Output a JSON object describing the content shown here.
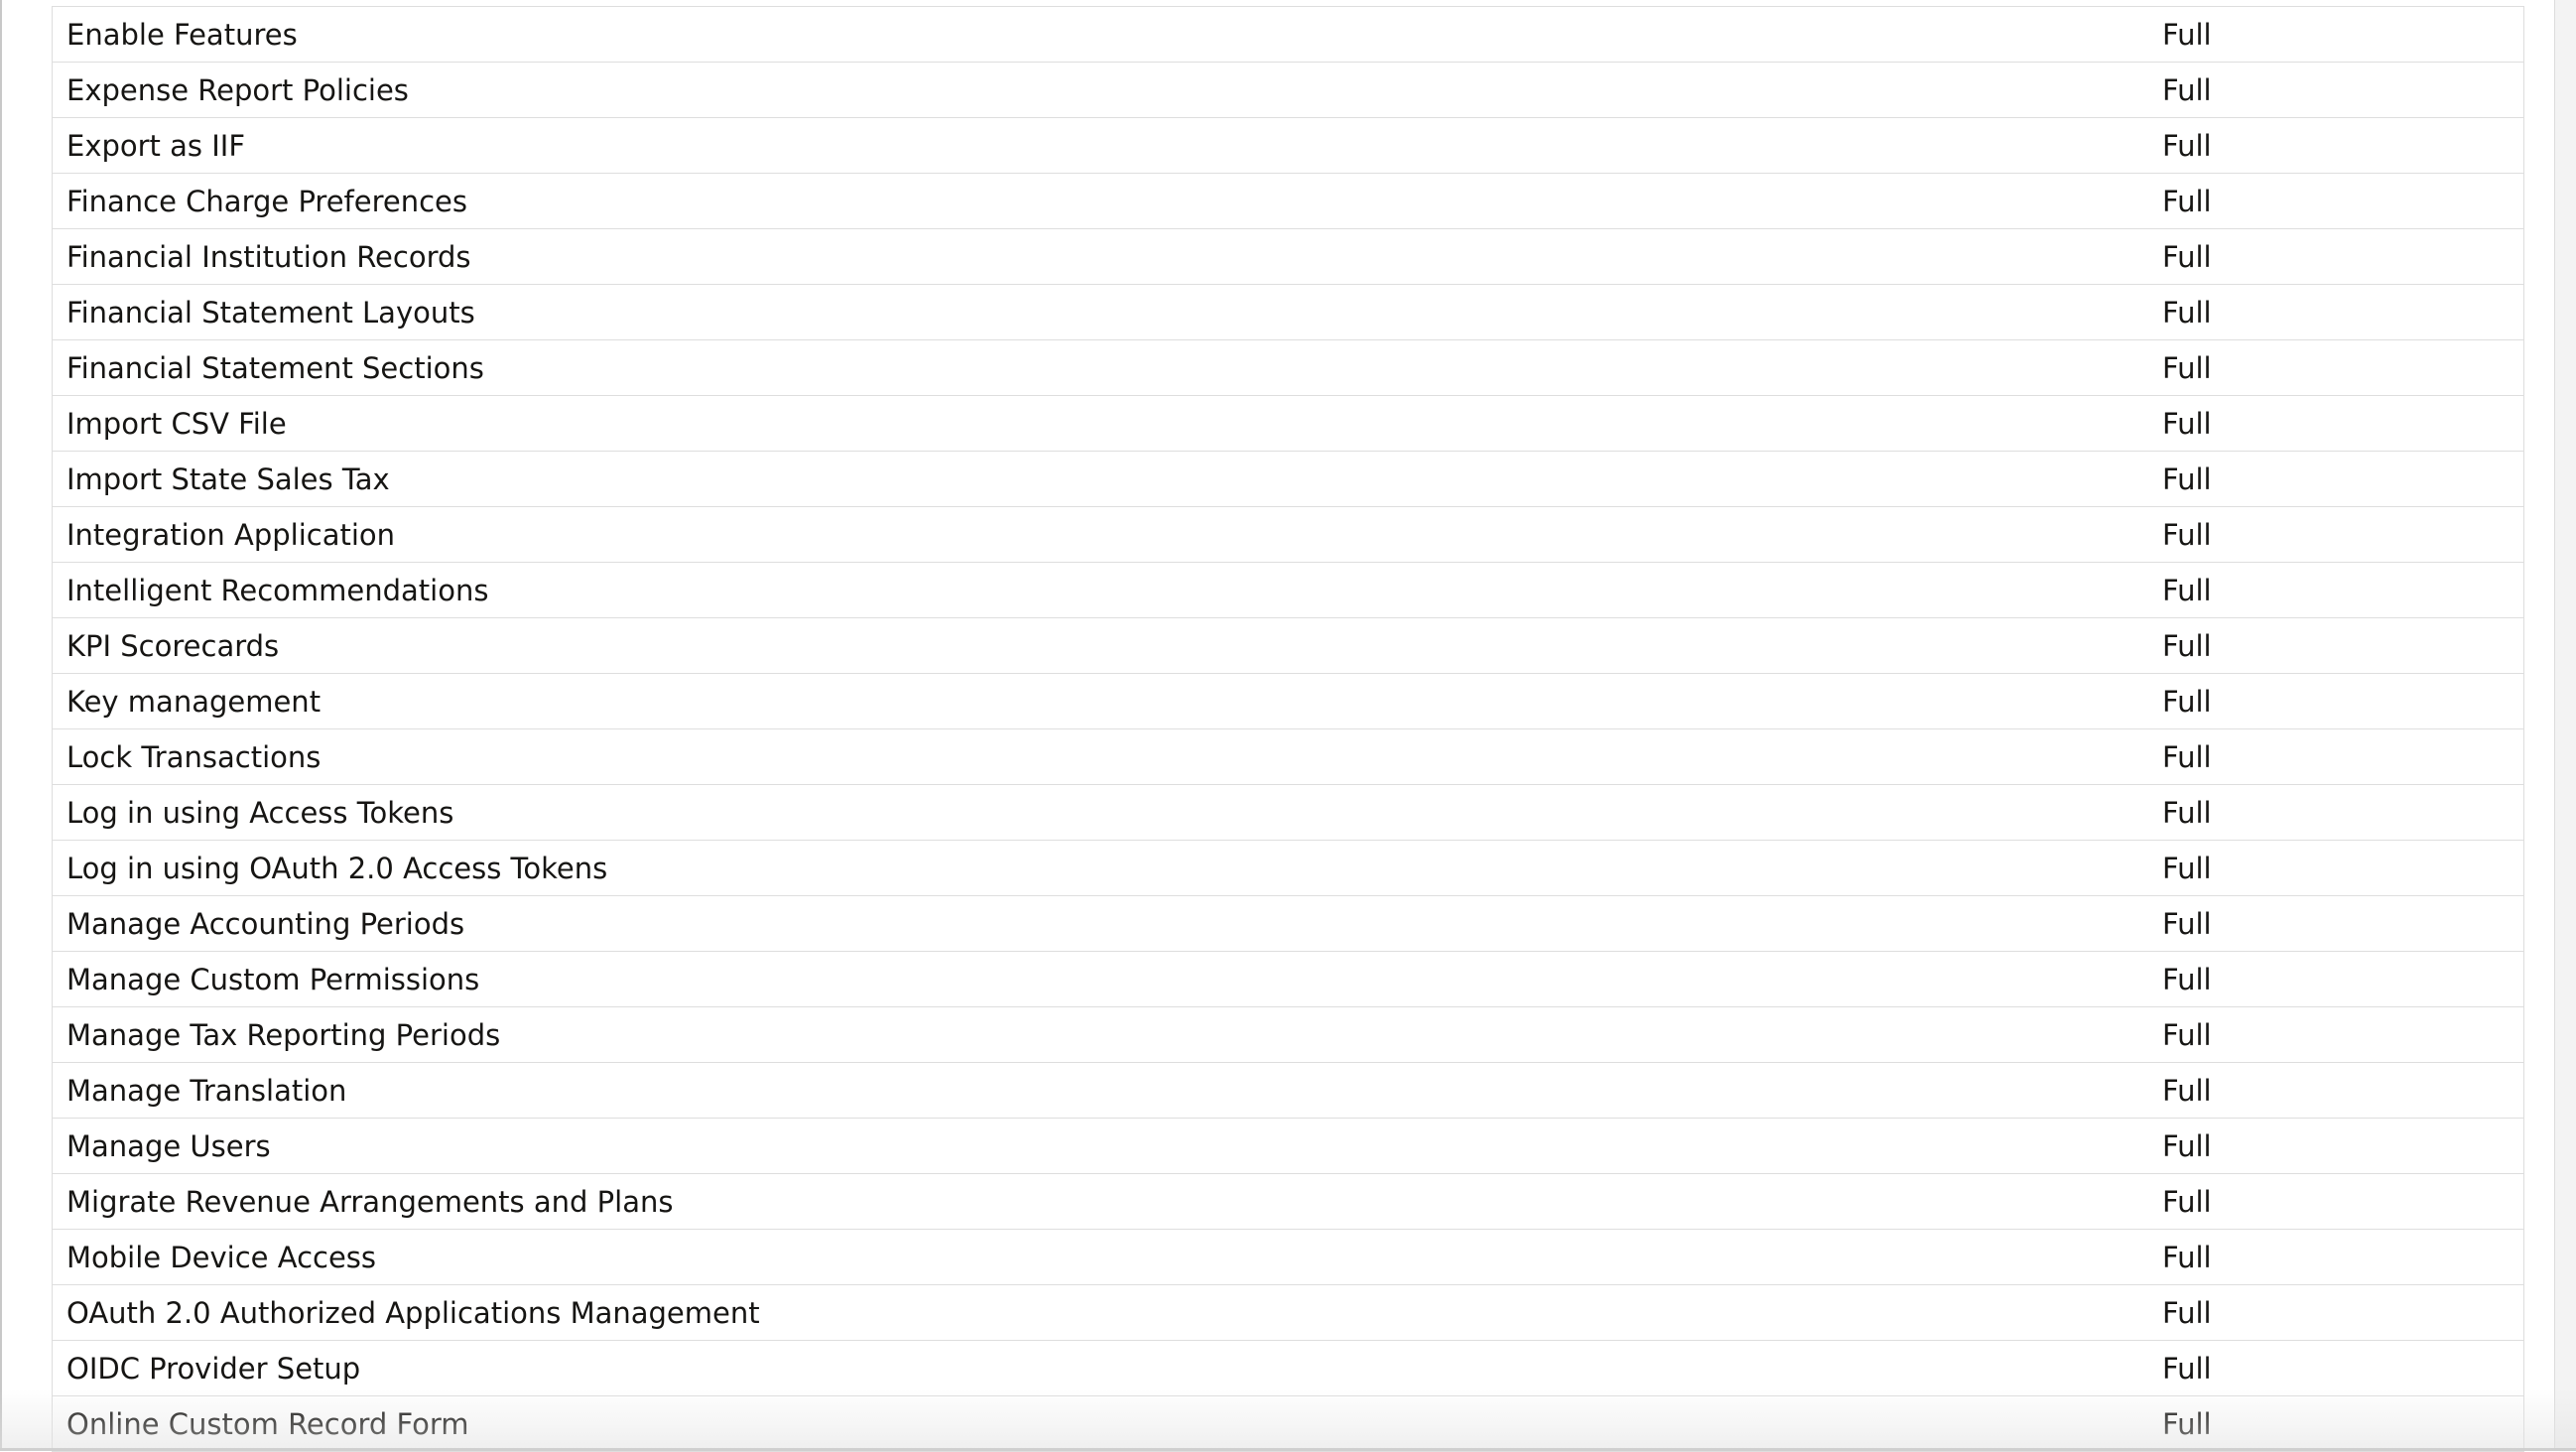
{
  "permissions_table": {
    "rows": [
      {
        "name": "Enable Features",
        "level": "Full"
      },
      {
        "name": "Expense Report Policies",
        "level": "Full"
      },
      {
        "name": "Export as IIF",
        "level": "Full"
      },
      {
        "name": "Finance Charge Preferences",
        "level": "Full"
      },
      {
        "name": "Financial Institution Records",
        "level": "Full"
      },
      {
        "name": "Financial Statement Layouts",
        "level": "Full"
      },
      {
        "name": "Financial Statement Sections",
        "level": "Full"
      },
      {
        "name": "Import CSV File",
        "level": "Full"
      },
      {
        "name": "Import State Sales Tax",
        "level": "Full"
      },
      {
        "name": "Integration Application",
        "level": "Full"
      },
      {
        "name": "Intelligent Recommendations",
        "level": "Full"
      },
      {
        "name": "KPI Scorecards",
        "level": "Full"
      },
      {
        "name": "Key management",
        "level": "Full"
      },
      {
        "name": "Lock Transactions",
        "level": "Full"
      },
      {
        "name": "Log in using Access Tokens",
        "level": "Full"
      },
      {
        "name": "Log in using OAuth 2.0 Access Tokens",
        "level": "Full"
      },
      {
        "name": "Manage Accounting Periods",
        "level": "Full"
      },
      {
        "name": "Manage Custom Permissions",
        "level": "Full"
      },
      {
        "name": "Manage Tax Reporting Periods",
        "level": "Full"
      },
      {
        "name": "Manage Translation",
        "level": "Full"
      },
      {
        "name": "Manage Users",
        "level": "Full"
      },
      {
        "name": "Migrate Revenue Arrangements and Plans",
        "level": "Full"
      },
      {
        "name": "Mobile Device Access",
        "level": "Full"
      },
      {
        "name": "OAuth 2.0 Authorized Applications Management",
        "level": "Full"
      },
      {
        "name": "OIDC Provider Setup",
        "level": "Full"
      },
      {
        "name": "Online Custom Record Form",
        "level": "Full"
      }
    ]
  }
}
